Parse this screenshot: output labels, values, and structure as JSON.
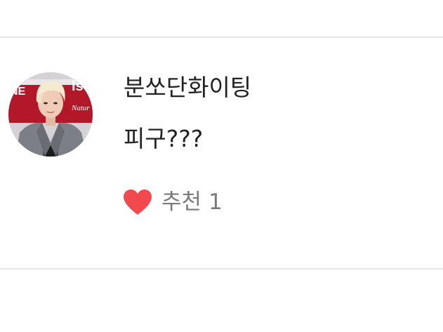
{
  "comment": {
    "author": "분쏘단화이팅",
    "text": "피구???",
    "like": {
      "label": "추천",
      "count": "1",
      "icon": "heart-icon",
      "color": "#f2494f"
    },
    "avatar_lettering": [
      "NEW",
      "Natur"
    ]
  },
  "theme": {
    "divider": "#e6e6e6",
    "text": "#222222",
    "muted_text": "#7a7a7a",
    "background": "#ffffff"
  }
}
